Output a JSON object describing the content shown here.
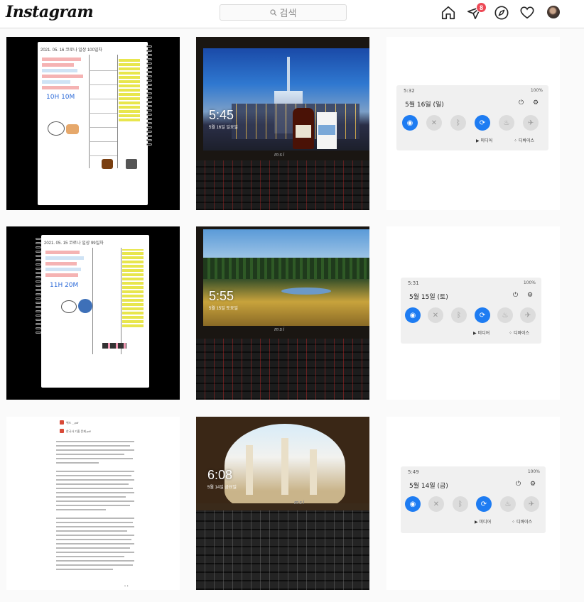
{
  "header": {
    "logo": "Instagram",
    "search_placeholder": "검색",
    "notification_count": "8"
  },
  "posts": [
    {
      "type": "notebook",
      "title": "2021. 05. 16 코로나 일상 100일차",
      "big_text": "10H 10M"
    },
    {
      "type": "laptop-city",
      "clock": "5:45",
      "date": "5월 16일 일요일"
    },
    {
      "type": "quick-panel",
      "time": "5:32",
      "status": "100%",
      "date": "5월 16일 (일)",
      "media": "미디어",
      "devices": "디바이스"
    },
    {
      "type": "notebook",
      "title": "2021. 05. 15 코로나 일상 99일차",
      "big_text": "11H 20M"
    },
    {
      "type": "laptop-field",
      "clock": "5:55",
      "date": "5월 15일 토요일"
    },
    {
      "type": "quick-panel",
      "time": "5:31",
      "status": "100%",
      "date": "5월 15일 (토)",
      "media": "미디어",
      "devices": "디바이스"
    },
    {
      "type": "document",
      "file1": "위드 _.pdf",
      "file2": "한국사 기출 문제.pdf"
    },
    {
      "type": "laptop-ruins",
      "clock": "6:08",
      "date": "5월 14일 금요일"
    },
    {
      "type": "quick-panel",
      "time": "5:49",
      "status": "100%",
      "date": "5월 14일 (금)",
      "media": "미디어",
      "devices": "디바이스"
    }
  ],
  "colors": {
    "accent_blue": "#1e7cf2",
    "badge_red": "#ed4956",
    "border": "#dbdbdb"
  }
}
